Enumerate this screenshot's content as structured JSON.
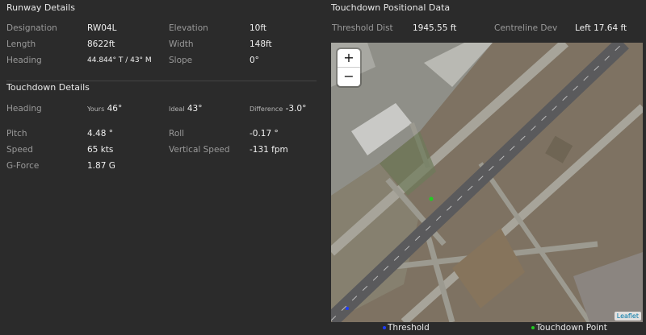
{
  "runway": {
    "title": "Runway Details",
    "designation_label": "Designation",
    "designation": "RW04L",
    "elevation_label": "Elevation",
    "elevation": "10ft",
    "length_label": "Length",
    "length": "8622ft",
    "width_label": "Width",
    "width": "148ft",
    "heading_label": "Heading",
    "heading": "44.844° T / 43° M",
    "slope_label": "Slope",
    "slope": "0°"
  },
  "touchdown": {
    "title": "Touchdown Details",
    "heading_label": "Heading",
    "yours_label": "Yours",
    "yours": "46°",
    "ideal_label": "Ideal",
    "ideal": "43°",
    "difference_label": "Difference",
    "difference": "-3.0°",
    "pitch_label": "Pitch",
    "pitch": "4.48 °",
    "roll_label": "Roll",
    "roll": "-0.17 °",
    "speed_label": "Speed",
    "speed": "65 kts",
    "vs_label": "Vertical Speed",
    "vs": "-131 fpm",
    "gforce_label": "G-Force",
    "gforce": "1.87 G"
  },
  "positional": {
    "title": "Touchdown Positional Data",
    "threshold_label": "Threshold Dist",
    "threshold": "1945.55 ft",
    "centreline_label": "Centreline Dev",
    "centreline": "Left 17.64 ft"
  },
  "map": {
    "zoom_in": "+",
    "zoom_out": "−",
    "attribution": "Leaflet",
    "threshold_color": "#1e3cff",
    "touchdown_color": "#22cc22"
  },
  "legend": {
    "threshold": "Threshold",
    "touchdown": "Touchdown Point"
  }
}
